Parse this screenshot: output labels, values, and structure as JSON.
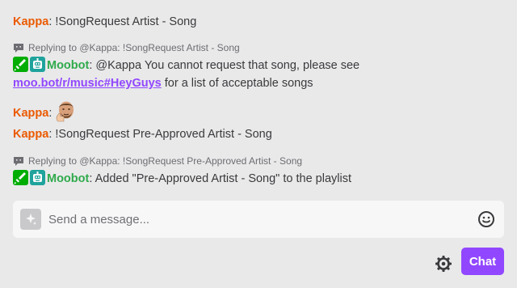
{
  "colors": {
    "kappa": "#eb5a00",
    "moobot": "#2faa4b",
    "link": "#9147ff",
    "chat_button": "#9147ff"
  },
  "messages": [
    {
      "type": "chat",
      "user": "Kappa",
      "separator": ":",
      "text": " !SongRequest Artist - Song"
    },
    {
      "type": "reply_context",
      "text": "Replying to @Kappa: !SongRequest Artist - Song"
    },
    {
      "type": "chat",
      "user": "Moobot",
      "separator": ":",
      "badges": [
        "moderator-sword-icon",
        "bot-icon"
      ],
      "text": " @Kappa You cannot request that song, please see",
      "link": "moo.bot/r/music#HeyGuys",
      "text_after": " for a list of acceptable songs"
    },
    {
      "type": "chat",
      "user": "Kappa",
      "separator": ":",
      "emote": "thumbs-up-face-emote"
    },
    {
      "type": "chat",
      "user": "Kappa",
      "separator": ":",
      "text": " !SongRequest Pre-Approved Artist - Song"
    },
    {
      "type": "reply_context",
      "text": "Replying to @Kappa: !SongRequest Pre-Approved Artist - Song"
    },
    {
      "type": "chat",
      "user": "Moobot",
      "separator": ":",
      "badges": [
        "moderator-sword-icon",
        "bot-icon"
      ],
      "text": " Added \"Pre-Approved Artist - Song\" to the playlist"
    }
  ],
  "composer": {
    "placeholder": "Send a message...",
    "left_icon": "sparkle-icon",
    "right_icon": "emoji-smile-icon"
  },
  "footer": {
    "settings_icon": "gear-icon",
    "chat_button_label": "Chat"
  }
}
